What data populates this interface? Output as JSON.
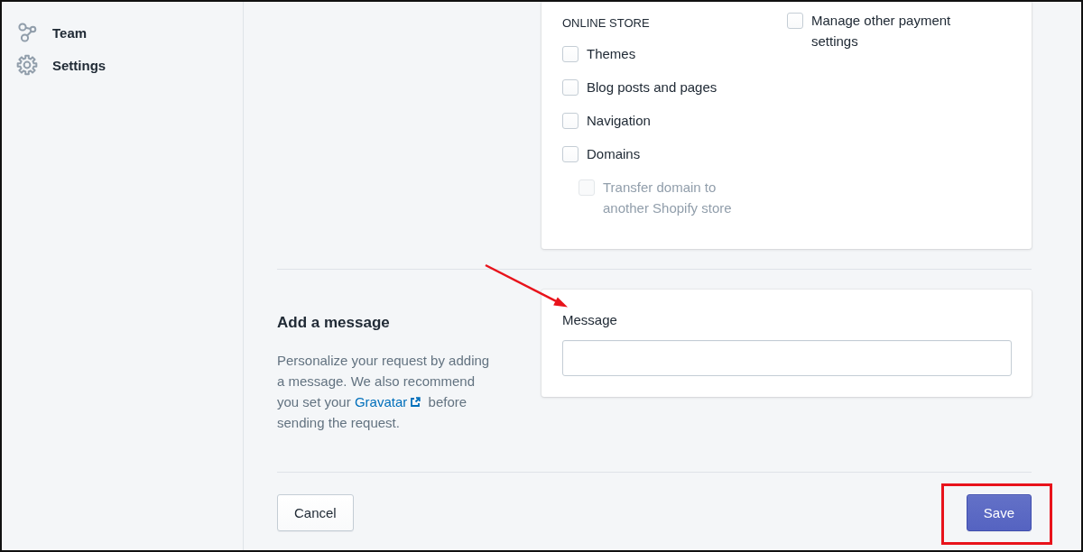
{
  "sidebar": {
    "items": [
      {
        "label": "Team",
        "kind": "team",
        "selected": false
      },
      {
        "label": "Settings",
        "kind": "settings",
        "selected": false
      }
    ]
  },
  "permissions": {
    "columns": [
      {
        "heading": "ONLINE STORE",
        "options": [
          {
            "label": "Themes",
            "checked": false,
            "disabled": false
          },
          {
            "label": "Blog posts and pages",
            "checked": false,
            "disabled": false
          },
          {
            "label": "Navigation",
            "checked": false,
            "disabled": false
          },
          {
            "label": "Domains",
            "checked": false,
            "disabled": false,
            "children": [
              {
                "label": "Transfer domain to another Shopify store",
                "checked": false,
                "disabled": true
              }
            ]
          }
        ]
      },
      {
        "options": [
          {
            "label": "Manage other payment settings",
            "checked": false,
            "disabled": false
          }
        ]
      }
    ]
  },
  "message_section": {
    "title": "Add a message",
    "description": {
      "before": "Personalize your request by adding a message. We also recommend you set your",
      "link": "Gravatar",
      "after": "before sending the request."
    },
    "field": {
      "label": "Message"
    }
  },
  "footer": {
    "buttons": [
      {
        "label": "Cancel",
        "kind": "secondary"
      },
      {
        "label": "Save",
        "kind": "primary"
      }
    ]
  },
  "annotations": {
    "arrow": true,
    "highlight_box": true
  }
}
